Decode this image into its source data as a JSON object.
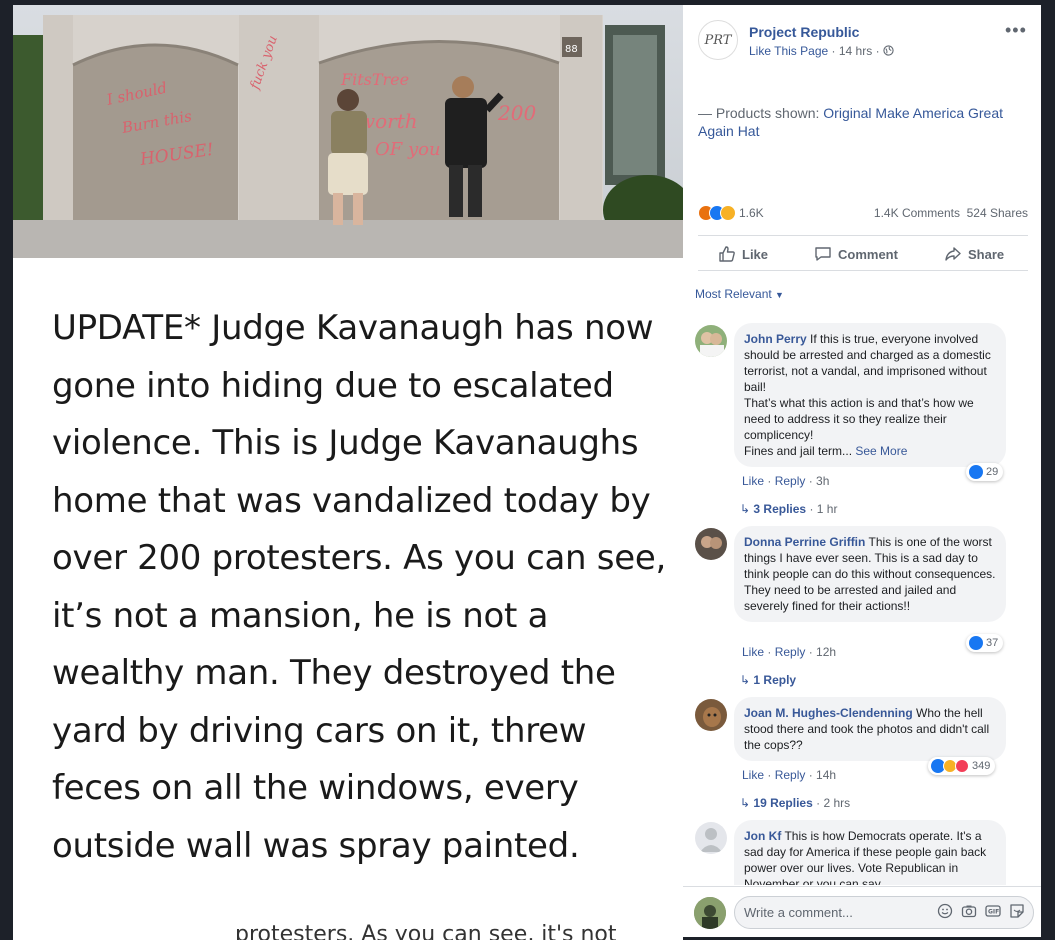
{
  "post": {
    "caption": "UPDATE* Judge Kavanaugh has now gone into hiding due to escalated violence. This is Judge Kavanaughs home that was vandalized today by over 200 protesters. As you can see, it’s not a mansion, he is not a wealthy man. They destroyed the yard by driving cars on it, threw feces on all the windows, every outside wall was spray painted.",
    "caption_bleed": "protesters. As you can see, it's not",
    "graffiti_left": "I should Burn this HOUSE!",
    "graffiti_middle": "fuck you",
    "graffiti_right": "FitsTree worth of you 200",
    "house_number": "88"
  },
  "page": {
    "logo_text": "PRT",
    "name": "Project Republic",
    "like_link": "Like This Page",
    "time": "14 hrs",
    "more_icon": "more-icon"
  },
  "products": {
    "prefix": "— Products shown: ",
    "link": "Original Make America Great Again Hat"
  },
  "stats": {
    "reactions": "1.6K",
    "comments_shares": "1.4K Comments  524 Shares"
  },
  "actions": {
    "like": "Like",
    "comment": "Comment",
    "share": "Share"
  },
  "sort": {
    "label": "Most Relevant"
  },
  "comments": [
    {
      "name": "John Perry",
      "text": "If this is true, everyone involved should be arrested and charged as a domestic terrorist, not a vandal, and imprisoned without bail!",
      "text2": "That’s what this action is and that’s how we need to address it so they realize their complicency!",
      "text3": "Fines and jail term... ",
      "see_more": "See More",
      "like": "Like",
      "reply": "Reply",
      "time": "3h",
      "reaction_count": "29",
      "replies": "3 Replies",
      "replies_time": "1 hr"
    },
    {
      "name": "Donna Perrine Griffin",
      "text": "This is one of the worst things I have ever seen. This is a sad day to think people can do this without consequences. They need to be arrested and jailed and severely fined for their actions!!",
      "like": "Like",
      "reply": "Reply",
      "time": "12h",
      "reaction_count": "37",
      "replies": "1 Reply"
    },
    {
      "name": "Joan M. Hughes-Clendenning",
      "text": "Who the hell stood there and took the photos and didn't call the cops??",
      "like": "Like",
      "reply": "Reply",
      "time": "14h",
      "reaction_count": "349",
      "replies": "19 Replies",
      "replies_time": "2 hrs"
    },
    {
      "name": "Jon Kf",
      "text": "This is how Democrats operate. It's a sad day for America if these people gain back power over our lives. Vote Republican in November or you can say"
    }
  ],
  "write": {
    "placeholder": "Write a comment..."
  },
  "colors": {
    "link": "#365899",
    "muted": "#606770",
    "like_blue": "#1877f2",
    "bg": "#1d2129"
  }
}
